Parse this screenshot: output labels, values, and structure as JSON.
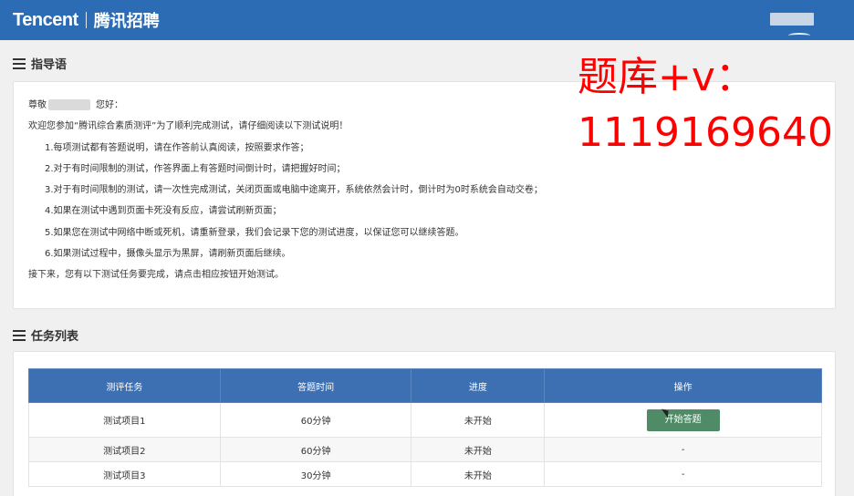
{
  "header": {
    "brand_en": "Tencent",
    "brand_cn": "腾讯招聘",
    "bg_color": "#2b6cb4"
  },
  "guide": {
    "title": "指导语",
    "greeting_prefix": "尊敬",
    "greeting_suffix": "您好：",
    "intro": "欢迎您参加“腾讯综合素质测评”为了顺利完成测试，请仔细阅读以下测试说明！",
    "items": [
      "1.每项测试都有答题说明，请在作答前认真阅读，按照要求作答；",
      "2.对于有时间限制的测试，作答界面上有答题时间倒计时，请把握好时间；",
      "3.对于有时间限制的测试，请一次性完成测试，关闭页面或电脑中途离开，系统依然会计时，倒计时为0时系统会自动交卷；",
      "4.如果在测试中遇到页面卡死没有反应，请尝试刷新页面；",
      "5.如果您在测试中网络中断或死机，请重新登录，我们会记录下您的测试进度，以保证您可以继续答题。",
      "6.如果测试过程中，摄像头显示为黑屏，请刷新页面后继续。"
    ],
    "outro": "接下来，您有以下测试任务要完成，请点击相应按钮开始测试。"
  },
  "watermark": {
    "line1": "题库+v：",
    "line2": "1119169640",
    "color": "#ff0000"
  },
  "tasks": {
    "title": "任务列表",
    "columns": [
      "测评任务",
      "答题时间",
      "进度",
      "操作"
    ],
    "rows": [
      {
        "name": "测试项目1",
        "time": "60分钟",
        "progress": "未开始",
        "action": "开始答题"
      },
      {
        "name": "测试项目2",
        "time": "60分钟",
        "progress": "未开始",
        "action": "-"
      },
      {
        "name": "测试项目3",
        "time": "30分钟",
        "progress": "未开始",
        "action": "-"
      }
    ],
    "header_color": "#3d70b2",
    "button_color": "#4f8b66"
  }
}
